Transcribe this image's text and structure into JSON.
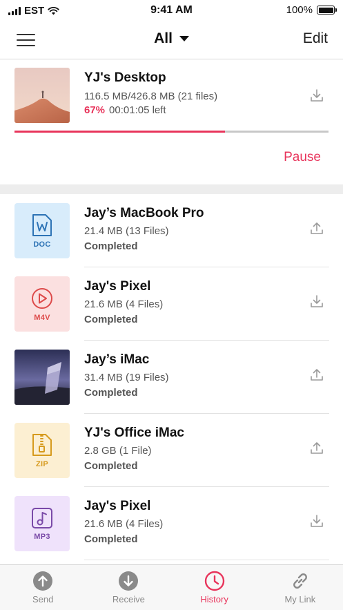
{
  "status_bar": {
    "carrier": "EST",
    "time": "9:41 AM",
    "battery": "100%"
  },
  "nav": {
    "title": "All",
    "edit_label": "Edit"
  },
  "active_transfer": {
    "title": "YJ's Desktop",
    "size": "116.5 MB/426.8 MB (21 files)",
    "percent": "67%",
    "time_left": "00:01:05 left",
    "progress": 0.67,
    "pause_label": "Pause",
    "action_icon": "download-icon"
  },
  "history": [
    {
      "title": "Jay’s MacBook Pro",
      "size": "21.4 MB (13 Files)",
      "status": "Completed",
      "badge": "DOC",
      "badge_icon": "doc-icon",
      "badge_bg": "#d8ecfb",
      "badge_color": "#2d73b5",
      "action_icon": "upload-icon"
    },
    {
      "title": "Jay's Pixel",
      "size": "21.6 MB (4 Files)",
      "status": "Completed",
      "badge": "M4V",
      "badge_icon": "video-icon",
      "badge_bg": "#fbe0e0",
      "badge_color": "#dd4a4a",
      "action_icon": "download-icon"
    },
    {
      "title": "Jay’s iMac",
      "size": "31.4 MB (19 Files)",
      "status": "Completed",
      "badge": "",
      "badge_icon": "photo-thumbnail",
      "action_icon": "upload-icon"
    },
    {
      "title": "YJ's Office iMac",
      "size": "2.8 GB (1 File)",
      "status": "Completed",
      "badge": "ZIP",
      "badge_icon": "zip-icon",
      "badge_bg": "#fcefd2",
      "badge_color": "#d69a1d",
      "action_icon": "upload-icon"
    },
    {
      "title": "Jay's Pixel",
      "size": "21.6 MB (4 Files)",
      "status": "Completed",
      "badge": "MP3",
      "badge_icon": "music-icon",
      "badge_bg": "#efe2fb",
      "badge_color": "#7a4aa8",
      "action_icon": "download-icon"
    }
  ],
  "tabs": [
    {
      "label": "Send",
      "icon": "send-icon"
    },
    {
      "label": "Receive",
      "icon": "receive-icon"
    },
    {
      "label": "History",
      "icon": "history-icon",
      "active": true
    },
    {
      "label": "My Link",
      "icon": "link-icon"
    }
  ],
  "colors": {
    "accent": "#e8345b",
    "track": "#c8c8c8",
    "divider": "#ededed"
  }
}
